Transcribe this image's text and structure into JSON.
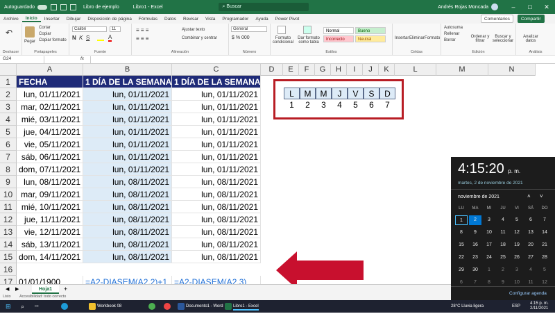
{
  "app": {
    "autosave": "Autoguardado",
    "doc_title": "Libro de ejemplo",
    "app_title": "Libro1 - Excel",
    "search": "Buscar",
    "user": "Andrés Rojas Moncada"
  },
  "ribbon_tabs": [
    "Archivo",
    "Inicio",
    "Insertar",
    "Dibujar",
    "Disposición de página",
    "Fórmulas",
    "Datos",
    "Revisar",
    "Vista",
    "Programador",
    "Ayuda",
    "Power Pivot"
  ],
  "ribbon_actions": {
    "comments": "Comentarios",
    "share": "Compartir"
  },
  "ribbon": {
    "groups": [
      "Deshacer",
      "Portapapeles",
      "Fuente",
      "Alineación",
      "Número",
      "Estilos",
      "Celdas",
      "Edición",
      "Análisis"
    ],
    "paste": "Pegar",
    "cut": "Cortar",
    "copy": "Copiar",
    "format_painter": "Copiar formato",
    "font_name": "Calibri",
    "font_size": "11",
    "wrap_text": "Ajustar texto",
    "merge_center": "Combinar y centrar",
    "number_format": "General",
    "conditional_format": "Formato condicional",
    "format_as_table": "Dar formato como tabla",
    "styles": [
      {
        "label": "Normal",
        "bg": "#ffffff",
        "fg": "#000000"
      },
      {
        "label": "Bueno",
        "bg": "#c6efce",
        "fg": "#006100"
      },
      {
        "label": "Incorrecto",
        "bg": "#ffc7ce",
        "fg": "#9c0006"
      },
      {
        "label": "Neutral",
        "bg": "#ffeb9c",
        "fg": "#9c5700"
      }
    ],
    "insert": "Insertar",
    "delete": "Eliminar",
    "format": "Formato",
    "autosum": "Autosuma",
    "fill": "Rellenar",
    "clear": "Borrar",
    "sort_filter": "Ordenar y filtrar",
    "find_select": "Buscar y seleccionar",
    "analyze": "Analizar datos"
  },
  "formula_bar": {
    "name_box": "G24",
    "fx": "fx"
  },
  "columns": [
    "A",
    "B",
    "C",
    "D",
    "E",
    "F",
    "G",
    "H",
    "I",
    "J",
    "K",
    "L",
    "M",
    "N"
  ],
  "rows": {
    "numbers": [
      "1",
      "2",
      "3",
      "4",
      "5",
      "6",
      "7",
      "8",
      "9",
      "10",
      "11",
      "12",
      "13",
      "14",
      "15",
      "16",
      "17"
    ],
    "headers": [
      "FECHA",
      "1 DÍA DE LA SEMANA",
      "1 DÍA DE LA SEMANA"
    ],
    "data": [
      [
        "lun, 01/11/2021",
        "lun, 01/11/2021",
        "lun, 01/11/2021"
      ],
      [
        "mar, 02/11/2021",
        "lun, 01/11/2021",
        "lun, 01/11/2021"
      ],
      [
        "mié, 03/11/2021",
        "lun, 01/11/2021",
        "lun, 01/11/2021"
      ],
      [
        "jue, 04/11/2021",
        "lun, 01/11/2021",
        "lun, 01/11/2021"
      ],
      [
        "vie, 05/11/2021",
        "lun, 01/11/2021",
        "lun, 01/11/2021"
      ],
      [
        "sáb, 06/11/2021",
        "lun, 01/11/2021",
        "lun, 01/11/2021"
      ],
      [
        "dom, 07/11/2021",
        "lun, 01/11/2021",
        "lun, 01/11/2021"
      ],
      [
        "lun, 08/11/2021",
        "lun, 08/11/2021",
        "lun, 08/11/2021"
      ],
      [
        "mar, 09/11/2021",
        "lun, 08/11/2021",
        "lun, 08/11/2021"
      ],
      [
        "mié, 10/11/2021",
        "lun, 08/11/2021",
        "lun, 08/11/2021"
      ],
      [
        "jue, 11/11/2021",
        "lun, 08/11/2021",
        "lun, 08/11/2021"
      ],
      [
        "vie, 12/11/2021",
        "lun, 08/11/2021",
        "lun, 08/11/2021"
      ],
      [
        "sáb, 13/11/2021",
        "lun, 08/11/2021",
        "lun, 08/11/2021"
      ],
      [
        "dom, 14/11/2021",
        "lun, 08/11/2021",
        "lun, 08/11/2021"
      ]
    ],
    "row17": [
      "01/01/1900",
      "=A2-DIASEM(A2,2)+1",
      "=A2-DIASEM(A2,3)"
    ]
  },
  "weekday_box": {
    "letters": [
      "L",
      "M",
      "M",
      "J",
      "V",
      "S",
      "D"
    ],
    "numbers": [
      "1",
      "2",
      "3",
      "4",
      "5",
      "6",
      "7"
    ]
  },
  "sheet": {
    "tab": "Hoja1",
    "add": "+"
  },
  "status": {
    "ready": "Listo",
    "accessibility": "Accesibilidad: todo correcto"
  },
  "clock": {
    "time": "4:15:20",
    "ampm": "p. m.",
    "date": "martes, 2 de noviembre de 2021",
    "month": "noviembre de 2021",
    "weekdays": [
      "LU",
      "MA",
      "MI",
      "JU",
      "VI",
      "SÁ",
      "DO"
    ],
    "weeks": [
      [
        "1",
        "2",
        "3",
        "4",
        "5",
        "6",
        "7"
      ],
      [
        "8",
        "9",
        "10",
        "11",
        "12",
        "13",
        "14"
      ],
      [
        "15",
        "16",
        "17",
        "18",
        "19",
        "20",
        "21"
      ],
      [
        "22",
        "23",
        "24",
        "25",
        "26",
        "27",
        "28"
      ],
      [
        "29",
        "30",
        "1",
        "2",
        "3",
        "4",
        "5"
      ],
      [
        "6",
        "7",
        "8",
        "9",
        "10",
        "11",
        "12"
      ]
    ],
    "agenda": "Configurar agenda"
  },
  "taskbar": {
    "items": [
      "Workbook 08",
      "Documento1 - Word",
      "Libro1 - Excel"
    ],
    "weather": "28°C  Lluvia ligera",
    "lang": "ESP",
    "time": "4:15 p. m.",
    "date": "2/11/2021"
  },
  "colors": {
    "excel_green": "#217346",
    "header_navy": "#1f2b78",
    "light_blue": "#ddebf7",
    "red_box": "#b81d24",
    "arrow": "#c8102e"
  }
}
